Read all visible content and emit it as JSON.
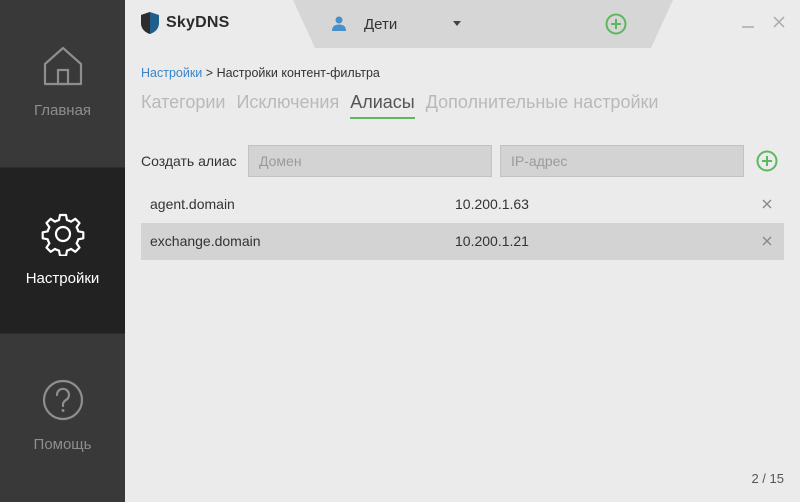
{
  "app": {
    "name": "SkyDNS"
  },
  "profile": {
    "name": "Дети"
  },
  "sidebar": {
    "items": [
      {
        "label": "Главная",
        "icon": "home-icon"
      },
      {
        "label": "Настройки",
        "icon": "gear-icon",
        "active": true
      },
      {
        "label": "Помощь",
        "icon": "help-icon"
      }
    ]
  },
  "breadcrumb": {
    "parent": "Настройки",
    "separator": ">",
    "current": "Настройки контент-фильтра"
  },
  "tabs": [
    {
      "label": "Категории"
    },
    {
      "label": "Исключения"
    },
    {
      "label": "Алиасы",
      "active": true
    },
    {
      "label": "Дополнительные настройки"
    }
  ],
  "create_alias": {
    "label": "Создать алиас",
    "domain_placeholder": "Домен",
    "ip_placeholder": "IP-адрес"
  },
  "aliases": [
    {
      "domain": "agent.domain",
      "ip": "10.200.1.63"
    },
    {
      "domain": "exchange.domain",
      "ip": "10.200.1.21"
    }
  ],
  "pager": {
    "text": "2 / 15"
  },
  "colors": {
    "accent": "#5cb85c",
    "link": "#3a86c8",
    "sidebar": "#393939",
    "sidebar_active": "#222222",
    "shield": "#1f5f8b"
  }
}
